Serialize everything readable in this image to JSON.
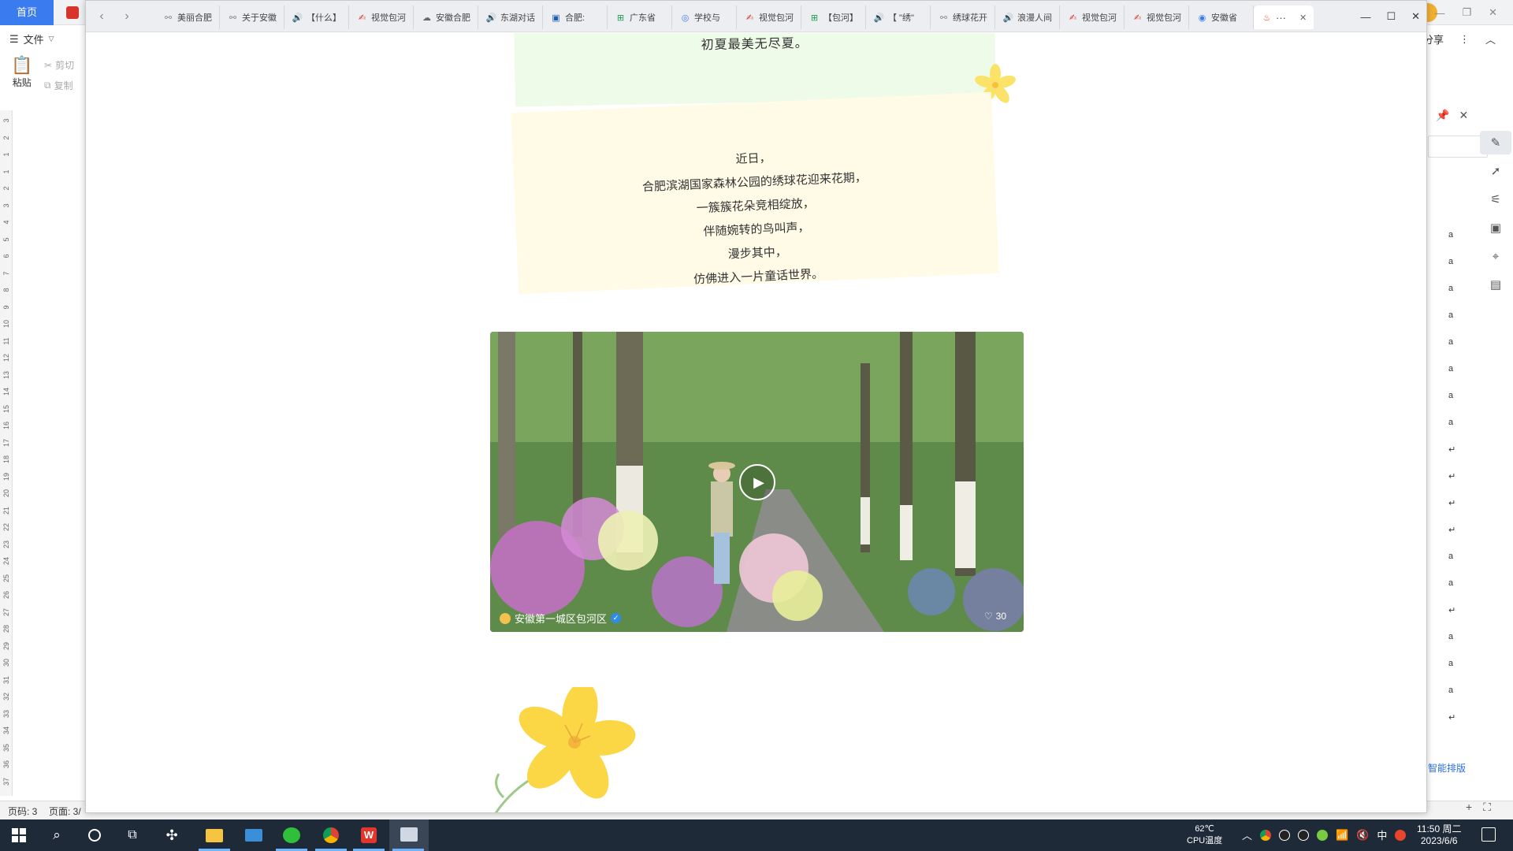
{
  "wps": {
    "home_tab": "首页",
    "menu_file": "文件",
    "share": "分享",
    "cut": "剪切",
    "copy": "复制",
    "paste": "粘贴",
    "smart_layout": "智能排版",
    "status_page": "页码: 3",
    "status_pages": "页面: 3/",
    "ruler_numbers": [
      "3",
      "2",
      "1",
      "1",
      "2",
      "3",
      "4",
      "5",
      "6",
      "7",
      "8",
      "9",
      "10",
      "11",
      "12",
      "13",
      "14",
      "15",
      "16",
      "17",
      "18",
      "19",
      "20",
      "21",
      "22",
      "23",
      "24",
      "25",
      "26",
      "27",
      "28",
      "29",
      "30",
      "31",
      "32",
      "33",
      "34",
      "35",
      "36",
      "37"
    ],
    "panel_marks": [
      "a",
      "a",
      "a",
      "a",
      "a",
      "a",
      "a",
      "a",
      "↵",
      "↵",
      "↵",
      "↵",
      "a",
      "a",
      "↵",
      "a",
      "a",
      "a",
      "↵"
    ]
  },
  "browser": {
    "tabs": [
      {
        "label": "美丽合肥",
        "icon": "link-icon",
        "color": "#888888"
      },
      {
        "label": "关于安徽",
        "icon": "link-icon",
        "color": "#888888"
      },
      {
        "label": "【什么】",
        "icon": "speaker-icon",
        "color": "#1aad19"
      },
      {
        "label": "视觉包河",
        "icon": "wps-icon",
        "color": "#d9342b"
      },
      {
        "label": "安徽合肥",
        "icon": "cloud-icon",
        "color": "#666666"
      },
      {
        "label": "东湖对话",
        "icon": "speaker-icon",
        "color": "#1aad19"
      },
      {
        "label": "合肥:",
        "icon": "doc-icon",
        "color": "#1b5fb5"
      },
      {
        "label": "广东省",
        "icon": "sheet-icon",
        "color": "#1b9e4b"
      },
      {
        "label": "学校与",
        "icon": "compass-icon",
        "color": "#3a7bf0"
      },
      {
        "label": "视觉包河",
        "icon": "wps-icon",
        "color": "#d9342b"
      },
      {
        "label": "【包河】",
        "icon": "sheet-icon",
        "color": "#1b9e4b"
      },
      {
        "label": "【 \"绣\"",
        "icon": "speaker-icon",
        "color": "#1aad19"
      },
      {
        "label": "绣球花开",
        "icon": "link-icon",
        "color": "#888888"
      },
      {
        "label": "浪漫人间",
        "icon": "speaker-icon",
        "color": "#1aad19"
      },
      {
        "label": "视觉包河",
        "icon": "wps-icon",
        "color": "#d9342b"
      },
      {
        "label": "视觉包河",
        "icon": "wps-icon",
        "color": "#d9342b"
      },
      {
        "label": "安徽省",
        "icon": "chrome-icon",
        "color": "#3a7bf0"
      }
    ],
    "active_tab_more": "···"
  },
  "article": {
    "green_card_text": "初夏最美无尽夏。",
    "poem": [
      "近日，",
      "合肥滨湖国家森林公园的绣球花迎来花期，",
      "一簇簇花朵竞相绽放，",
      "伴随婉转的鸟叫声，",
      "漫步其中，",
      "仿佛进入一片童话世界。"
    ],
    "video": {
      "source": "安徽第一城区包河区",
      "likes": "30"
    }
  },
  "taskbar": {
    "temp": "62℃",
    "temp_label": "CPU温度",
    "ime": "中",
    "time": "11:50 周二",
    "date": "2023/6/6"
  }
}
